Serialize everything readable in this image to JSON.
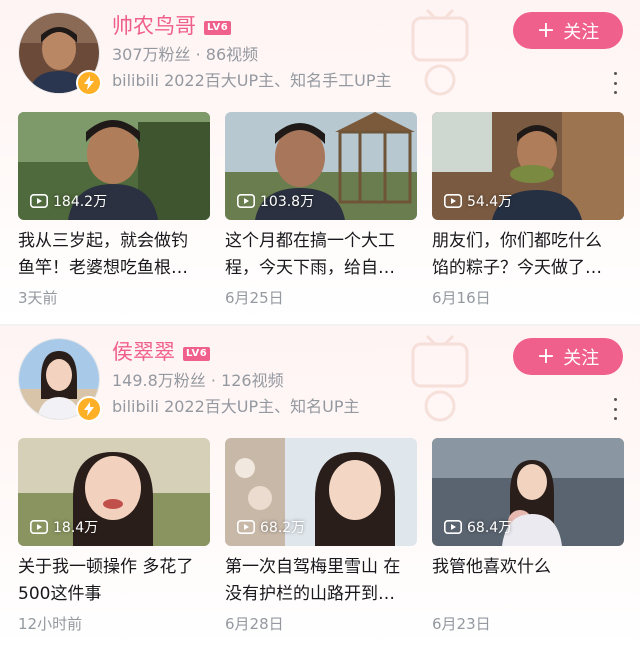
{
  "cards": [
    {
      "name": "帅农鸟哥",
      "level": "LV6",
      "stats": "307万粉丝 · 86视频",
      "description": "bilibili 2022百大UP主、知名手工UP主",
      "follow_label": "关注",
      "videos": [
        {
          "views": "184.2万",
          "title_line1": "我从三岁起，就会做钓",
          "title_line2": "鱼竿！老婆想吃鱼根…",
          "date": "3天前"
        },
        {
          "views": "103.8万",
          "title_line1": "这个月都在搞一个大工",
          "title_line2": "程，今天下雨，给自…",
          "date": "6月25日"
        },
        {
          "views": "54.4万",
          "title_line1": "朋友们，你们都吃什么",
          "title_line2": "馅的粽子？今天做了…",
          "date": "6月16日"
        }
      ]
    },
    {
      "name": "侯翠翠",
      "level": "LV6",
      "stats": "149.8万粉丝 · 126视频",
      "description": "bilibili 2022百大UP主、知名UP主",
      "follow_label": "关注",
      "videos": [
        {
          "views": "18.4万",
          "title_line1": "关于我一顿操作 多花了",
          "title_line2": "500这件事",
          "date": "12小时前"
        },
        {
          "views": "68.2万",
          "title_line1": "第一次自驾梅里雪山 在",
          "title_line2": "没有护栏的山路开到…",
          "date": "6月28日"
        },
        {
          "views": "68.4万",
          "title_line1": "我管他喜欢什么",
          "title_line2": "",
          "date": "6月23日"
        }
      ]
    }
  ],
  "colors": {
    "accent": "#f0608c",
    "muted": "#9499a0",
    "badge": "#ffb027"
  },
  "icons": {
    "follow": "plus-icon",
    "verified": "lightning-icon",
    "views": "play-icon",
    "more": "more-vertical-icon"
  }
}
